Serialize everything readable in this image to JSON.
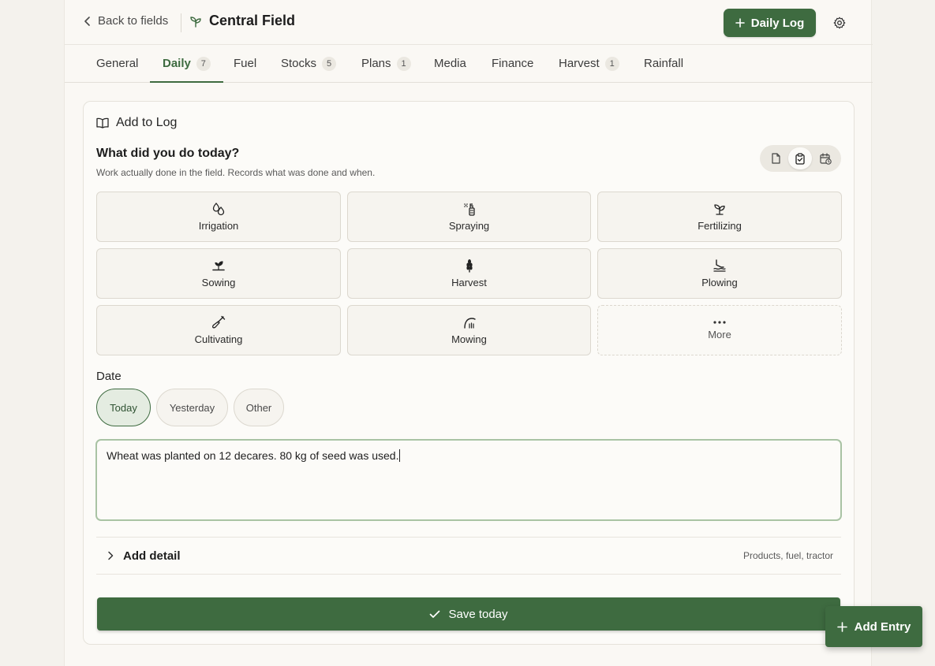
{
  "header": {
    "back_label": "Back to fields",
    "field_name": "Central Field",
    "daily_log_label": "Daily Log",
    "settings_icon": "gear-icon"
  },
  "tabs": [
    {
      "label": "General",
      "badge": ""
    },
    {
      "label": "Daily",
      "badge": "7",
      "active": true
    },
    {
      "label": "Fuel",
      "badge": ""
    },
    {
      "label": "Stocks",
      "badge": "5"
    },
    {
      "label": "Plans",
      "badge": "1"
    },
    {
      "label": "Media",
      "badge": ""
    },
    {
      "label": "Finance",
      "badge": ""
    },
    {
      "label": "Harvest",
      "badge": "1"
    },
    {
      "label": "Rainfall",
      "badge": ""
    }
  ],
  "card": {
    "title": "Add to Log",
    "question": "What did you do today?",
    "subtitle": "Work actually done in the field. Records what was done and when.",
    "modes": [
      "note-icon",
      "clipboard-check-icon",
      "calendar-clock-icon"
    ],
    "activities": [
      {
        "label": "Irrigation",
        "icon": "droplets-icon"
      },
      {
        "label": "Spraying",
        "icon": "spray-bottle-icon"
      },
      {
        "label": "Fertilizing",
        "icon": "sprout-icon"
      },
      {
        "label": "Sowing",
        "icon": "seedling-icon"
      },
      {
        "label": "Harvest",
        "icon": "wheat-icon"
      },
      {
        "label": "Plowing",
        "icon": "plow-icon"
      },
      {
        "label": "Cultivating",
        "icon": "shovel-icon"
      },
      {
        "label": "Mowing",
        "icon": "scythe-icon"
      },
      {
        "label": "More",
        "icon": "more-dots-icon"
      }
    ],
    "date_label": "Date",
    "date_options": [
      "Today",
      "Yesterday",
      "Other"
    ],
    "note_text": "Wheat was planted on 12 decares. 80 kg of seed was used.",
    "add_detail_label": "Add detail",
    "add_detail_hint": "Products, fuel, tractor",
    "save_label": "Save today"
  },
  "fab": {
    "label": "Add Entry"
  },
  "colors": {
    "accent": "#3e6b40",
    "background": "#faf8f4",
    "active_pill": "#e4ece1"
  }
}
